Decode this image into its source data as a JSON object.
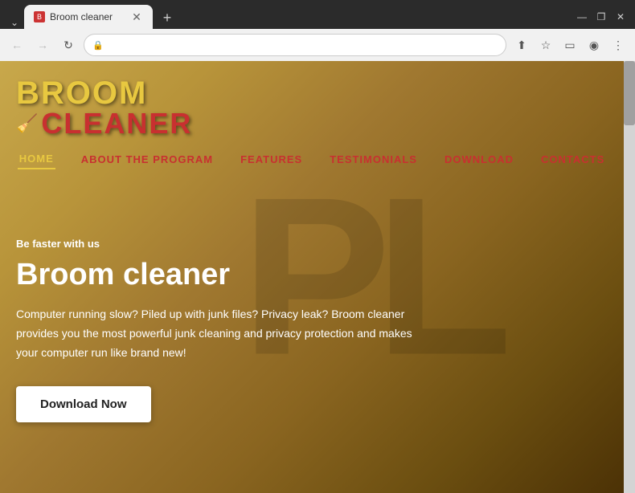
{
  "browser": {
    "tab": {
      "title": "Broom cleaner",
      "icon_label": "broom-icon"
    },
    "new_tab_label": "+",
    "window_controls": {
      "minimize": "—",
      "maximize": "❐",
      "close": "✕",
      "chevron": "⌄"
    },
    "toolbar": {
      "back_label": "←",
      "forward_label": "→",
      "reload_label": "↻",
      "lock_label": "🔒",
      "address": "",
      "share_label": "⬆",
      "bookmark_label": "☆",
      "sidebar_label": "▭",
      "profile_label": "◉",
      "menu_label": "⋮"
    }
  },
  "webpage": {
    "logo": {
      "broom_text": "BROOM",
      "cleaner_text": "CLEANER",
      "icon": "🧹"
    },
    "nav": {
      "items": [
        {
          "label": "HOME",
          "state": "active"
        },
        {
          "label": "ABOUT THE PROGRAM",
          "state": "inactive"
        },
        {
          "label": "FEATURES",
          "state": "inactive"
        },
        {
          "label": "TESTIMONIALS",
          "state": "inactive"
        },
        {
          "label": "DOWNLOAD",
          "state": "inactive"
        },
        {
          "label": "CONTACTS",
          "state": "inactive"
        }
      ]
    },
    "watermark": "PL",
    "hero": {
      "tagline": "Be faster with us",
      "title": "Broom cleaner",
      "description": "Computer running slow? Piled up with junk files? Privacy leak? Broom cleaner provides you the most powerful junk cleaning and privacy protection and makes your computer run like brand new!",
      "download_button": "Download Now"
    }
  }
}
